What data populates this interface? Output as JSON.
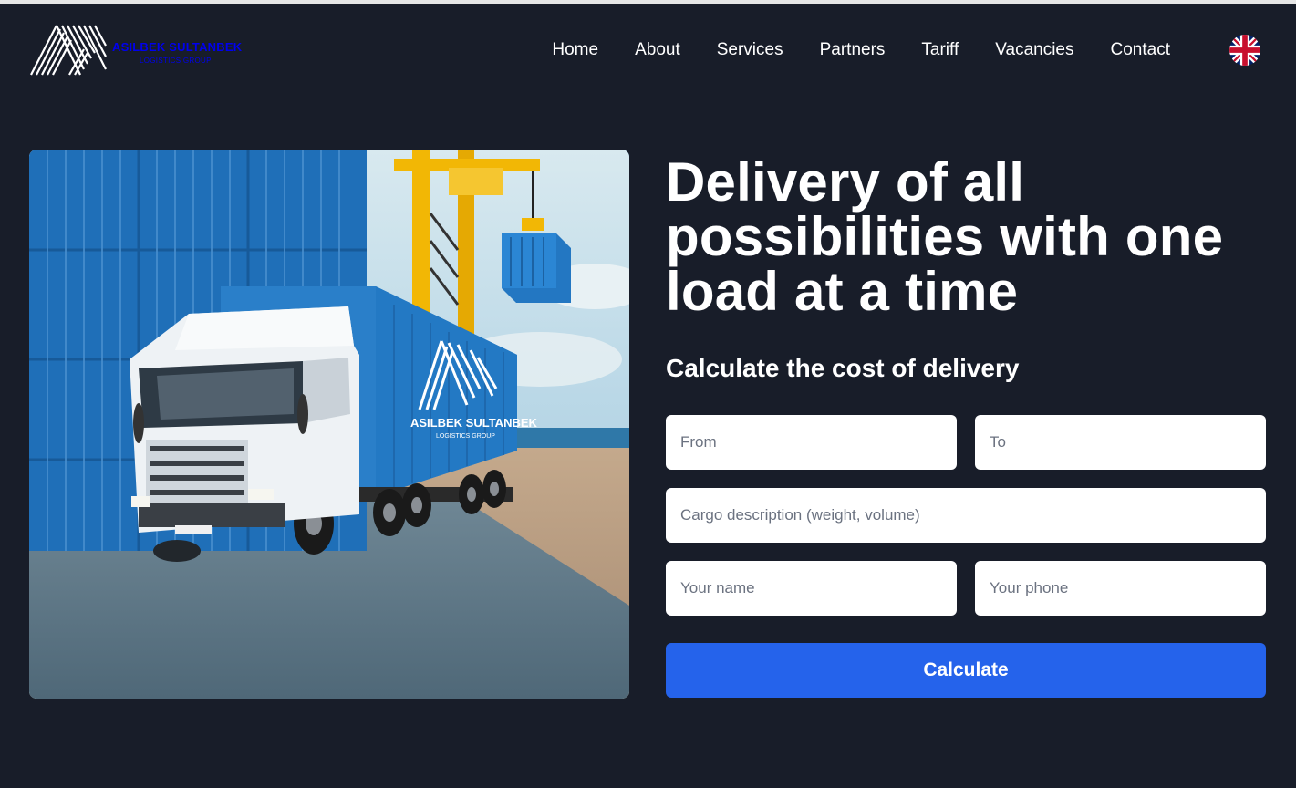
{
  "brand": {
    "name": "ASILBEK SULTANBEK",
    "subtitle": "LOGISTICS GROUP"
  },
  "nav": {
    "items": [
      {
        "label": "Home"
      },
      {
        "label": "About"
      },
      {
        "label": "Services"
      },
      {
        "label": "Partners"
      },
      {
        "label": "Tariff"
      },
      {
        "label": "Vacancies"
      },
      {
        "label": "Contact"
      }
    ],
    "language_icon": "uk-flag-icon"
  },
  "hero": {
    "image_icon": "truck-container-port-image",
    "trailer_brand": "ASILBEK SULTANBEK",
    "trailer_sub": "LOGISTICS GROUP",
    "headline": "Delivery of all possibilities with one load at a time"
  },
  "form": {
    "title": "Calculate the cost of delivery",
    "from": {
      "value": "",
      "placeholder": "From"
    },
    "to": {
      "value": "",
      "placeholder": "To"
    },
    "cargo": {
      "value": "",
      "placeholder": "Cargo description (weight, volume)"
    },
    "name": {
      "value": "",
      "placeholder": "Your name"
    },
    "phone": {
      "value": "",
      "placeholder": "Your phone"
    },
    "submit_label": "Calculate"
  },
  "colors": {
    "background": "#181d29",
    "accent": "#2563eb",
    "text": "#ffffff"
  }
}
